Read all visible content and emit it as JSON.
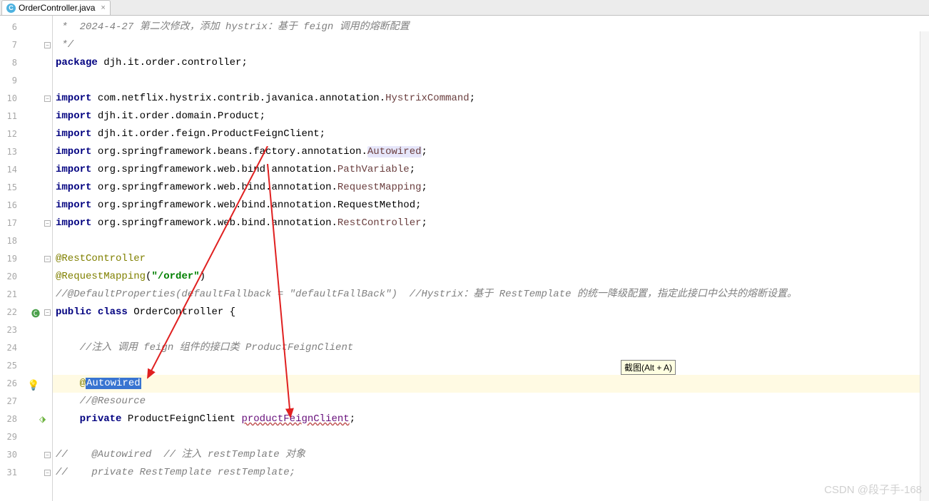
{
  "tab": {
    "filename": "OrderController.java"
  },
  "tooltip": "截图(Alt + A)",
  "watermark": "CSDN @段子手-168",
  "gutter_start": 6,
  "lines": [
    {
      "n": 6,
      "fold": "",
      "html": " <span class='comment'>*  2024-4-27 第二次修改，添加 hystrix：基于 feign 调用的熔断配置</span>"
    },
    {
      "n": 7,
      "fold": "-",
      "html": " <span class='comment'>*/</span>"
    },
    {
      "n": 8,
      "fold": "",
      "html": "<span class='kw'>package</span> djh.it.order.controller;"
    },
    {
      "n": 9,
      "fold": "",
      "html": ""
    },
    {
      "n": 10,
      "fold": "-",
      "html": "<span class='kw'>import</span> com.netflix.hystrix.contrib.javanica.annotation.<span class='cls'>HystrixCommand</span>;"
    },
    {
      "n": 11,
      "fold": "",
      "html": "<span class='kw'>import</span> djh.it.order.domain.Product;"
    },
    {
      "n": 12,
      "fold": "",
      "html": "<span class='kw'>import</span> djh.it.order.feign.ProductFeignClient;"
    },
    {
      "n": 13,
      "fold": "",
      "html": "<span class='kw'>import</span> org.springframework.beans.factory.annotation.<span class='hlsel'>Autowired</span>;"
    },
    {
      "n": 14,
      "fold": "",
      "html": "<span class='kw'>import</span> org.springframework.web.bind.annotation.<span class='cls'>PathVariable</span>;"
    },
    {
      "n": 15,
      "fold": "",
      "html": "<span class='kw'>import</span> org.springframework.web.bind.annotation.<span class='cls'>RequestMapping</span>;"
    },
    {
      "n": 16,
      "fold": "",
      "html": "<span class='kw'>import</span> org.springframework.web.bind.annotation.RequestMethod;"
    },
    {
      "n": 17,
      "fold": "-",
      "html": "<span class='kw'>import</span> org.springframework.web.bind.annotation.<span class='cls'>RestController</span>;"
    },
    {
      "n": 18,
      "fold": "",
      "html": ""
    },
    {
      "n": 19,
      "fold": "-",
      "html": "<span class='anno'>@RestController</span>"
    },
    {
      "n": 20,
      "fold": "",
      "html": "<span class='anno'>@RequestMapping</span>(<span class='str'>\"/order\"</span>)"
    },
    {
      "n": 21,
      "fold": "",
      "html": "<span class='comment'>//@DefaultProperties(defaultFallback = \"defaultFallBack\")  //Hystrix：基于 RestTemplate 的统一降级配置，指定此接口中公共的熔断设置。</span>"
    },
    {
      "n": 22,
      "fold": "-",
      "icon": "class",
      "html": "<span class='kw'>public</span> <span class='kw'>class</span> OrderController {"
    },
    {
      "n": 23,
      "fold": "",
      "html": ""
    },
    {
      "n": 24,
      "fold": "",
      "html": "    <span class='comment'>//注入 调用 feign 组件的接口类 ProductFeignClient</span>"
    },
    {
      "n": 25,
      "fold": "",
      "html": ""
    },
    {
      "n": 26,
      "fold": "",
      "hl": true,
      "bulb": true,
      "html": "    <span class='anno'>@</span><span class='selblue'>Autowired</span>"
    },
    {
      "n": 27,
      "fold": "",
      "html": "    <span class='comment'>//@Resource</span>"
    },
    {
      "n": 28,
      "fold": "",
      "icon": "bean",
      "html": "    <span class='kw'>private</span> ProductFeignClient <span class='field field-wavy'>productFeignClient</span>;"
    },
    {
      "n": 29,
      "fold": "",
      "html": ""
    },
    {
      "n": 30,
      "fold": "-",
      "html": "<span class='comment'>//    @Autowired  // 注入 restTemplate 对象</span>"
    },
    {
      "n": 31,
      "fold": "-",
      "html": "<span class='comment'>//    private RestTemplate restTemplate;</span>"
    }
  ]
}
